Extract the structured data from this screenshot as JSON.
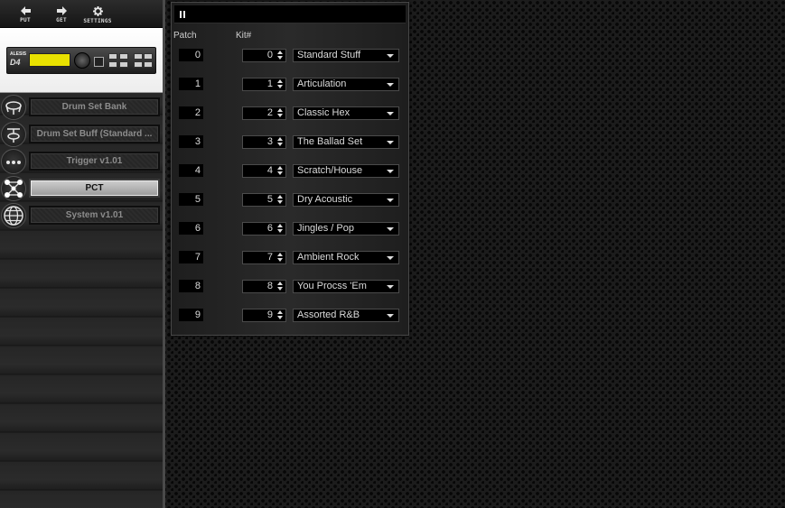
{
  "toolbar": {
    "buttons": [
      {
        "label": "PUT",
        "icon": "arrow-left-icon"
      },
      {
        "label": "GET",
        "icon": "arrow-right-icon"
      },
      {
        "label": "SETTINGS",
        "icon": "gear-icon"
      }
    ]
  },
  "device": {
    "logo": "ALESIS",
    "model": "D4"
  },
  "nav": {
    "items": [
      {
        "label": "Drum Set Bank",
        "icon": "drum-icon",
        "active": false
      },
      {
        "label": "Drum Set Buff (Standard ...",
        "icon": "drum-stand-icon",
        "active": false
      },
      {
        "label": "Trigger v1.01",
        "icon": "dots-icon",
        "active": false
      },
      {
        "label": "PCT",
        "icon": "network-icon",
        "active": true
      },
      {
        "label": "System v1.01",
        "icon": "globe-icon",
        "active": false
      }
    ]
  },
  "table": {
    "patch_header": "Patch",
    "kit_header": "Kit#",
    "rows": [
      {
        "patch": "0",
        "kit": "0",
        "name": "Standard Stuff"
      },
      {
        "patch": "1",
        "kit": "1",
        "name": "Articulation"
      },
      {
        "patch": "2",
        "kit": "2",
        "name": "Classic Hex"
      },
      {
        "patch": "3",
        "kit": "3",
        "name": "The Ballad Set"
      },
      {
        "patch": "4",
        "kit": "4",
        "name": "Scratch/House"
      },
      {
        "patch": "5",
        "kit": "5",
        "name": "Dry Acoustic"
      },
      {
        "patch": "6",
        "kit": "6",
        "name": "Jingles / Pop"
      },
      {
        "patch": "7",
        "kit": "7",
        "name": "Ambient Rock"
      },
      {
        "patch": "8",
        "kit": "8",
        "name": "You Procss 'Em"
      },
      {
        "patch": "9",
        "kit": "9",
        "name": "Assorted R&B"
      }
    ]
  },
  "colors": {
    "accent_lcd": "#e9e200",
    "active_nav": "#b5b5b5"
  }
}
